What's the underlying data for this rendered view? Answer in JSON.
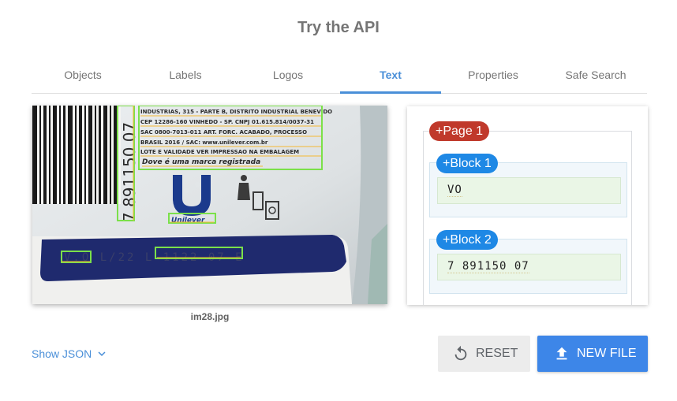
{
  "title": "Try the API",
  "tabs": [
    {
      "label": "Objects"
    },
    {
      "label": "Labels"
    },
    {
      "label": "Logos"
    },
    {
      "label": "Text",
      "active": true
    },
    {
      "label": "Properties"
    },
    {
      "label": "Safe Search"
    }
  ],
  "image": {
    "filename": "im28.jpg",
    "printed_text": {
      "line1": "INDUSTRIAS, 315 - PARTE B, DISTRITO INDUSTRIAL BENEVIDO",
      "line2": "CEP 12286-160 VINHEDO - SP. CNPJ 01.615.814/0037-31",
      "line3": "SAC 0800-7013-011 ART. FORC. ACABADO, PROCESSO",
      "line4": "BRASIL 2016 / SAC: www.unilever.com.br",
      "line5": "LOTE E VALIDADE VER IMPRESSAO NA EMBALAGEM",
      "tagline": "Dove é uma marca registrada",
      "barcode_digits": "7 891150 07",
      "logo_text": "Unilever",
      "band_text": "V.O  L/22  L  1122 07  E"
    }
  },
  "results": {
    "page_label": "+Page 1",
    "blocks": [
      {
        "label": "+Block 1",
        "text": "VO"
      },
      {
        "label": "+Block 2",
        "text": "7 891150 07"
      }
    ]
  },
  "show_json": "Show JSON",
  "buttons": {
    "reset": "RESET",
    "new_file": "NEW FILE"
  },
  "colors": {
    "accent": "#4a8fd8",
    "page_chip": "#c0392b",
    "block_chip": "#1e88e5",
    "primary_button": "#3d86e8",
    "detection_box": "#7be04a",
    "word_underline": "#f5b833"
  },
  "icons": {
    "show_json": "chevron-down-icon",
    "reset": "reset-icon",
    "new_file": "upload-icon"
  }
}
